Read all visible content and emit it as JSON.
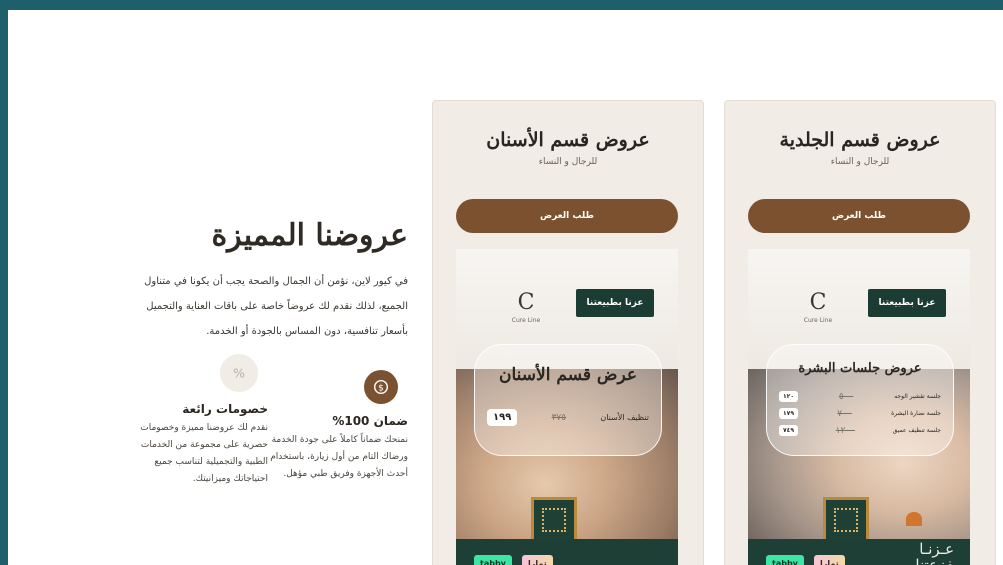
{
  "intro": {
    "title": "عروضنا المميزة",
    "description": "في كيور لاين، نؤمن أن الجمال والصحة يجب أن يكونا في متناول الجميع، لذلك نقدم لك عروضاً خاصة على باقات العناية والتجميل بأسعار تنافسية، دون المساس بالجودة أو الخدمة."
  },
  "features": [
    {
      "icon": "guarantee-icon",
      "title": "ضمان 100%",
      "text": "نمنحك ضماناً كاملاً على جودة الخدمة ورضاك التام من أول زيارة، باستخدام أحدث الأجهزة وفريق طبي مؤهل."
    },
    {
      "icon": "percent-icon",
      "title": "خصومات رائعة",
      "text": "نقدم لك عروضنا مميزة وخصومات حصرية على مجموعة من الخدمات الطبية والتجميلية لتناسب جميع احتياجاتك وميزانيتك."
    }
  ],
  "cards": [
    {
      "title": "عروض قسم الأسنان",
      "subtitle": "للرجال و النساء",
      "button": "طلب العرض",
      "logo_text": "Cure Line",
      "badge": "عزنا بطبيعتنا",
      "promo_title": "عرض قسم الأسنان",
      "promo_service": "تنظيف الأسنان",
      "promo_price_new": "١٩٩",
      "promo_price_old": "٣٧٥",
      "pay_tabby": "tabby",
      "pay_tamara": "تمارا"
    },
    {
      "title": "عروض قسم الجلدية",
      "subtitle": "للرجال و النساء",
      "button": "طلب العرض",
      "logo_text": "Cure Line",
      "badge": "عزنا بطبيعتنا",
      "promo_title": "عروض جلسات البشرة",
      "price_rows": [
        {
          "label": "جلسة تقشير الوجه",
          "old": "٥٠٠",
          "new": "١٢٠"
        },
        {
          "label": "جلسة نضارة البشرة",
          "old": "٧٠٠",
          "new": "١٧٩"
        },
        {
          "label": "جلسة تنظيف عميق",
          "old": "١٢٠٠",
          "new": "٧٤٩"
        }
      ],
      "slogan_1": "عـزنـا",
      "slogan_2": "بفزعتنا",
      "pay_tabby": "tabby",
      "pay_tamara": "تمارا"
    }
  ]
}
